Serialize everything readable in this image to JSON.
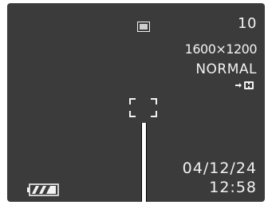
{
  "display": {
    "shots_remaining": "10",
    "resolution": "1600×1200",
    "quality": "NORMAL",
    "date": "04/12/24",
    "time": "12:58"
  },
  "icons": {
    "record_mode": "single-frame-icon",
    "storage": "built-in-memory-icon",
    "battery": "battery-full-icon",
    "focus": "focus-frame-icon"
  },
  "colors": {
    "screen_background": "#3b3b3b",
    "osd_text": "#f2f2f2"
  }
}
